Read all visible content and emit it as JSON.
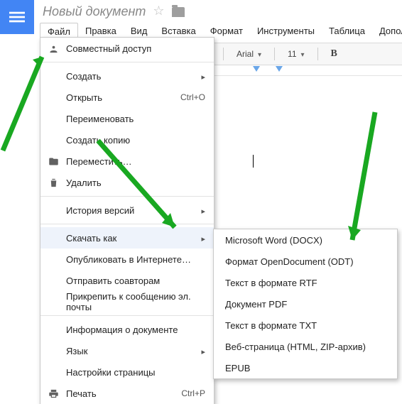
{
  "header": {
    "doc_title": "Новый документ"
  },
  "menubar": {
    "items": [
      "Файл",
      "Правка",
      "Вид",
      "Вставка",
      "Формат",
      "Инструменты",
      "Таблица",
      "Дополнения"
    ]
  },
  "toolbar": {
    "font": "Arial",
    "size": "11",
    "bold": "B"
  },
  "file_menu": {
    "share": "Совместный доступ",
    "new": "Создать",
    "open": {
      "label": "Открыть",
      "shortcut": "Ctrl+O"
    },
    "rename": "Переименовать",
    "make_copy": "Создать копию",
    "move": "Переместить…",
    "delete": "Удалить",
    "version_history": "История версий",
    "download_as": "Скачать как",
    "publish": "Опубликовать в Интернете…",
    "email_collab": "Отправить соавторам",
    "email_attach": "Прикрепить к сообщению эл. почты",
    "doc_info": "Информация о документе",
    "language": "Язык",
    "page_setup": "Настройки страницы",
    "print": {
      "label": "Печать",
      "shortcut": "Ctrl+P"
    }
  },
  "download_submenu": {
    "docx": "Microsoft Word (DOCX)",
    "odt": "Формат OpenDocument (ODT)",
    "rtf": "Текст в формате RTF",
    "pdf": "Документ PDF",
    "txt": "Текст в формате TXT",
    "html": "Веб-страница (HTML, ZIP-архив)",
    "epub": "EPUB"
  }
}
